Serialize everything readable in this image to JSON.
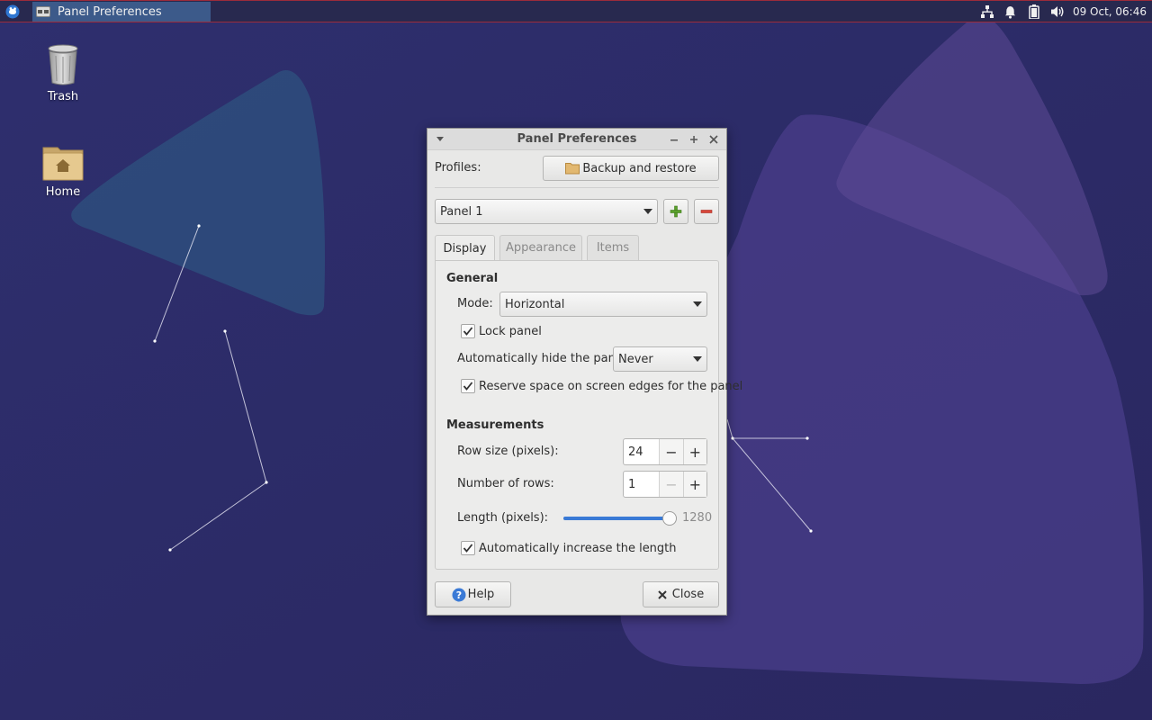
{
  "panel": {
    "task_title": "Panel Preferences",
    "clock": "09 Oct, 06:46",
    "tray_icons": [
      "network-icon",
      "notification-bell-icon",
      "battery-icon",
      "volume-icon"
    ]
  },
  "desktop": {
    "icons": [
      {
        "label": "Trash",
        "icon": "trash-icon"
      },
      {
        "label": "Home",
        "icon": "home-folder-icon"
      }
    ]
  },
  "dialog": {
    "title": "Panel Preferences",
    "profiles_label": "Profiles:",
    "backup_button": "Backup and restore",
    "panel_select": "Panel 1",
    "tabs": [
      {
        "label": "Display",
        "active": true
      },
      {
        "label": "Appearance",
        "active": false
      },
      {
        "label": "Items",
        "active": false
      }
    ],
    "general": {
      "heading": "General",
      "mode_label": "Mode:",
      "mode_value": "Horizontal",
      "lock_panel": {
        "label": "Lock panel",
        "checked": true
      },
      "autohide_label": "Automatically hide the panel:",
      "autohide_value": "Never",
      "reserve_space": {
        "label": "Reserve space on screen edges for the panel",
        "checked": true
      }
    },
    "measurements": {
      "heading": "Measurements",
      "row_size_label": "Row size (pixels):",
      "row_size_value": "24",
      "rows_label": "Number of rows:",
      "rows_value": "1",
      "length_label": "Length (pixels):",
      "length_value": "1280",
      "length_fraction": 1.0,
      "auto_length": {
        "label": "Automatically increase the length",
        "checked": true
      }
    },
    "help_button": "Help",
    "close_button": "Close"
  },
  "colors": {
    "desktop_bg": "#2b2a66",
    "panel_bg": "#28294f",
    "task_active": "#3c5a8a",
    "accent": "#3a7ad6"
  }
}
